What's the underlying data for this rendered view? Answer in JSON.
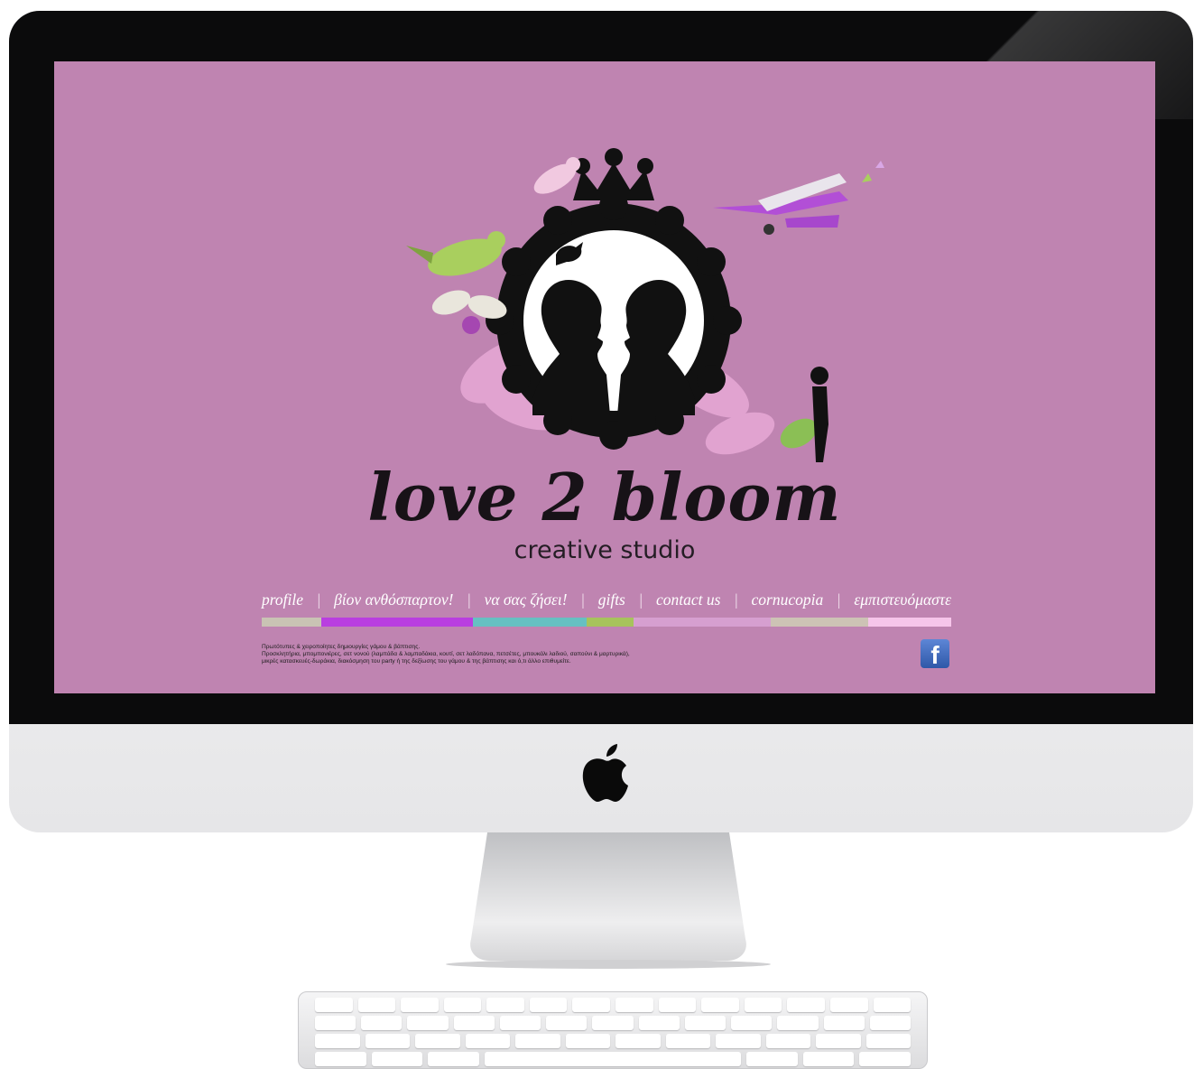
{
  "site": {
    "title": "love 2 bloom",
    "subtitle": "creative studio",
    "background_color": "#bf84b1"
  },
  "nav": {
    "items": [
      {
        "label": "profile"
      },
      {
        "label": "βίον ανθόσπαρτον!"
      },
      {
        "label": "να σας ζήσει!"
      },
      {
        "label": "gifts"
      },
      {
        "label": "contact us"
      },
      {
        "label": "cornucopia"
      },
      {
        "label": "εμπιστευόμαστε"
      }
    ],
    "separator": "|"
  },
  "color_bar": [
    "#c9c3b4",
    "#b93ee0",
    "#66c0c2",
    "#a7c35c",
    "#d69fd0",
    "#cdc3b5",
    "#f6c5ea"
  ],
  "footer": {
    "line1": "Πρωτότυπες & χειροποίητες δημιουργίες γάμου & βάπτισης.",
    "line2": "Προσκλητήρια, μπομπονιέρες, σετ νονού (λαμπάδα & λαμπαδάκια, κουτί, σετ λαδόπανα, πετσέτες, μπουκάλι λαδιού, σαπούνι & μαρτυρικά),",
    "line3": "μικρές κατασκευές-δωράκια, διακόσμηση του party ή της δεξίωσης του γάμου & της βάπτισης και ό,τι άλλο επιθυμείτε."
  },
  "social": {
    "facebook_glyph": "f",
    "icon": "facebook-icon"
  },
  "device": {
    "logo_icon": "apple-icon"
  }
}
